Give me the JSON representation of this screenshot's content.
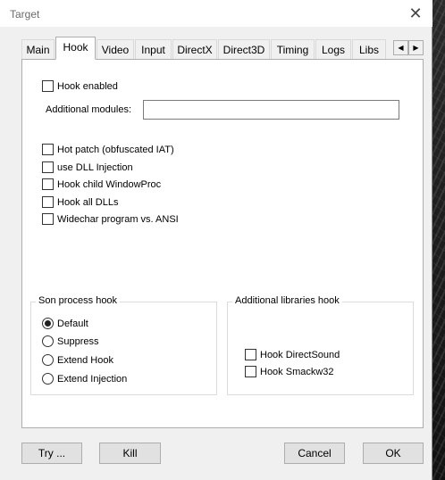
{
  "window": {
    "title": "Target",
    "close_glyph": "✕"
  },
  "tabs": [
    "Main",
    "Hook",
    "Video",
    "Input",
    "DirectX",
    "Direct3D",
    "Timing",
    "Logs",
    "Libs"
  ],
  "active_tab": "Hook",
  "tab_scroll": {
    "left_glyph": "◀",
    "right_glyph": "▶"
  },
  "hook": {
    "hook_enabled": {
      "label": "Hook enabled",
      "checked": false
    },
    "additional_modules": {
      "label": "Additional modules:",
      "value": ""
    },
    "options": [
      {
        "label": "Hot patch (obfuscated IAT)",
        "checked": false
      },
      {
        "label": "use DLL Injection",
        "checked": false
      },
      {
        "label": "Hook child WindowProc",
        "checked": false
      },
      {
        "label": "Hook all DLLs",
        "checked": false
      },
      {
        "label": "Widechar program vs. ANSI",
        "checked": false
      }
    ],
    "son_process_hook": {
      "title": "Son process hook",
      "options": [
        "Default",
        "Suppress",
        "Extend Hook",
        "Extend Injection"
      ],
      "selected": "Default"
    },
    "additional_libraries_hook": {
      "title": "Additional libraries hook",
      "options": [
        {
          "label": "Hook DirectSound",
          "checked": false
        },
        {
          "label": "Hook Smackw32",
          "checked": false
        }
      ]
    }
  },
  "buttons": {
    "try": "Try ...",
    "kill": "Kill",
    "cancel": "Cancel",
    "ok": "OK"
  }
}
